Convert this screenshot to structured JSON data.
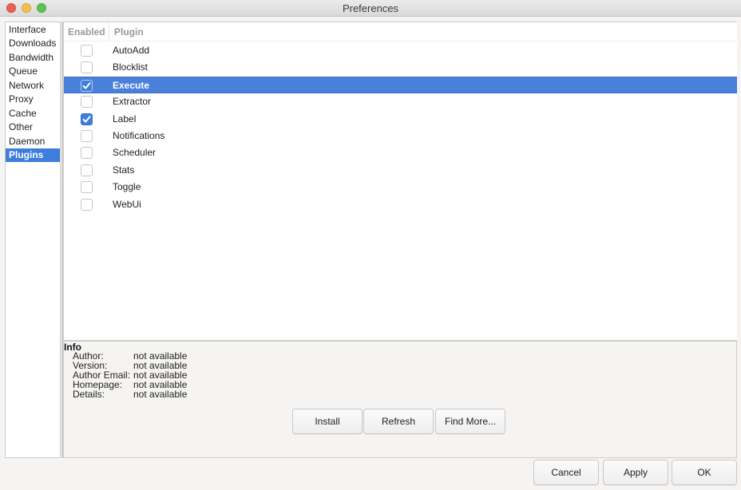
{
  "window": {
    "title": "Preferences"
  },
  "sidebar": {
    "items": [
      {
        "label": "Interface",
        "selected": false
      },
      {
        "label": "Downloads",
        "selected": false
      },
      {
        "label": "Bandwidth",
        "selected": false
      },
      {
        "label": "Queue",
        "selected": false
      },
      {
        "label": "Network",
        "selected": false
      },
      {
        "label": "Proxy",
        "selected": false
      },
      {
        "label": "Cache",
        "selected": false
      },
      {
        "label": "Other",
        "selected": false
      },
      {
        "label": "Daemon",
        "selected": false
      },
      {
        "label": "Plugins",
        "selected": true
      }
    ]
  },
  "plugins_table": {
    "columns": {
      "enabled": "Enabled",
      "plugin": "Plugin"
    },
    "rows": [
      {
        "name": "AutoAdd",
        "enabled": false,
        "selected": false
      },
      {
        "name": "Blocklist",
        "enabled": false,
        "selected": false
      },
      {
        "name": "Execute",
        "enabled": true,
        "selected": true
      },
      {
        "name": "Extractor",
        "enabled": false,
        "selected": false
      },
      {
        "name": "Label",
        "enabled": true,
        "selected": false
      },
      {
        "name": "Notifications",
        "enabled": false,
        "selected": false
      },
      {
        "name": "Scheduler",
        "enabled": false,
        "selected": false
      },
      {
        "name": "Stats",
        "enabled": false,
        "selected": false
      },
      {
        "name": "Toggle",
        "enabled": false,
        "selected": false
      },
      {
        "name": "WebUi",
        "enabled": false,
        "selected": false
      }
    ]
  },
  "info": {
    "title": "Info",
    "fields": [
      {
        "label": "Author:",
        "value": "not available"
      },
      {
        "label": "Version:",
        "value": "not available"
      },
      {
        "label": "Author Email:",
        "value": "not available"
      },
      {
        "label": "Homepage:",
        "value": "not available"
      },
      {
        "label": "Details:",
        "value": "not available"
      }
    ]
  },
  "plugin_buttons": {
    "install": "Install",
    "refresh": "Refresh",
    "find_more": "Find More..."
  },
  "dialog_buttons": {
    "cancel": "Cancel",
    "apply": "Apply",
    "ok": "OK"
  },
  "colors": {
    "selection": "#4a7fdb",
    "checkbox_checked": "#3e7fde"
  }
}
